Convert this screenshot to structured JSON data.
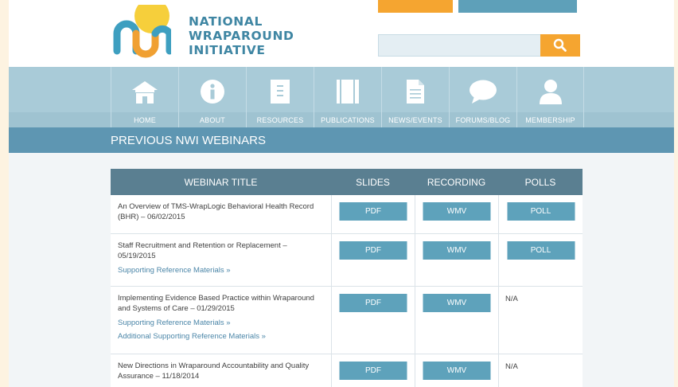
{
  "brand": {
    "line1": "NATIONAL",
    "line2": "WRAPAROUND",
    "line3": "INITIATIVE"
  },
  "search": {
    "placeholder": ""
  },
  "nav": [
    {
      "label": "HOME",
      "icon": "home-icon"
    },
    {
      "label": "ABOUT",
      "icon": "info-icon"
    },
    {
      "label": "RESOURCES",
      "icon": "resources-icon"
    },
    {
      "label": "PUBLICATIONS",
      "icon": "book-icon"
    },
    {
      "label": "NEWS/EVENTS",
      "icon": "document-icon"
    },
    {
      "label": "FORUMS/BLOG",
      "icon": "chat-bubble-icon"
    },
    {
      "label": "MEMBERSHIP",
      "icon": "user-icon"
    }
  ],
  "page_title": "PREVIOUS NWI WEBINARS",
  "table": {
    "headers": [
      "WEBINAR TITLE",
      "SLIDES",
      "RECORDING",
      "POLLS"
    ],
    "rows": [
      {
        "title": "An Overview of TMS-WrapLogic Behavioral Health Record (BHR) – 06/02/2015",
        "links": [],
        "slides": "PDF",
        "recording": "WMV",
        "polls": "POLL",
        "polls_is_button": true
      },
      {
        "title": "Staff Recruitment and Retention or Replacement – 05/19/2015",
        "links": [
          "Supporting Reference Materials »"
        ],
        "slides": "PDF",
        "recording": "WMV",
        "polls": "POLL",
        "polls_is_button": true
      },
      {
        "title": "Implementing Evidence Based Practice within Wraparound and Systems of Care – 01/29/2015",
        "links": [
          "Supporting Reference Materials »",
          "Additional Supporting Reference Materials »"
        ],
        "slides": "PDF",
        "recording": "WMV",
        "polls": "N/A",
        "polls_is_button": false
      },
      {
        "title": "New Directions in Wraparound Accountability and Quality Assurance – 11/18/2014",
        "links": [],
        "slides": "PDF",
        "recording": "WMV",
        "polls": "N/A",
        "polls_is_button": false
      }
    ]
  },
  "colors": {
    "accent_orange": "#f5a530",
    "header_blue": "#5e96b2",
    "table_header": "#5a7f91",
    "button_blue": "#5ea2bb",
    "logo_teal": "#3f86a3"
  }
}
